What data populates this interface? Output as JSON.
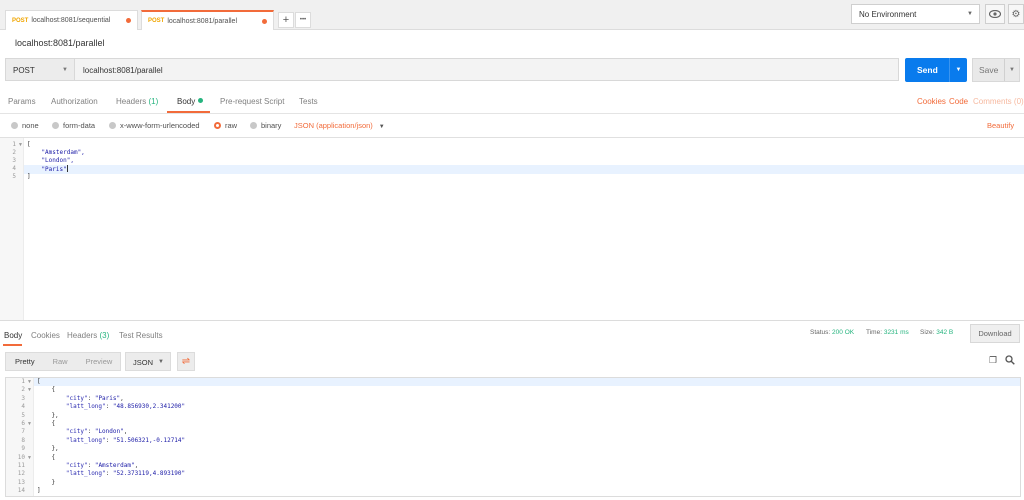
{
  "tabs": [
    {
      "method": "POST",
      "url": "localhost:8081/sequential"
    },
    {
      "method": "POST",
      "url": "localhost:8081/parallel"
    }
  ],
  "tab_actions": {
    "add": "+",
    "more": "•••"
  },
  "environment": {
    "selected": "No Environment"
  },
  "request": {
    "title": "localhost:8081/parallel",
    "method": "POST",
    "url": "localhost:8081/parallel",
    "send_label": "Send",
    "save_label": "Save"
  },
  "request_tabs": {
    "params": "Params",
    "authorization": "Authorization",
    "headers": "Headers",
    "headers_count": "(1)",
    "body": "Body",
    "prerequest": "Pre-request Script",
    "tests": "Tests",
    "cookies": "Cookies",
    "code": "Code",
    "comments": "Comments (0)"
  },
  "body_options": {
    "none": "none",
    "form_data": "form-data",
    "urlencoded": "x-www-form-urlencoded",
    "raw": "raw",
    "binary": "binary",
    "content_type": "JSON (application/json)",
    "beautify": "Beautify",
    "selected": "raw"
  },
  "request_body": {
    "line_numbers": [
      "1",
      "2",
      "3",
      "4",
      "5"
    ],
    "lines": [
      "[",
      "    \"Amsterdam\",",
      "    \"London\",",
      "    \"Paris\"",
      "]"
    ]
  },
  "response_tabs": {
    "body": "Body",
    "cookies": "Cookies",
    "headers": "Headers",
    "headers_count": "(3)",
    "test_results": "Test Results"
  },
  "response_status": {
    "status_label": "Status:",
    "status_value": "200 OK",
    "time_label": "Time:",
    "time_value": "3231 ms",
    "size_label": "Size:",
    "size_value": "342 B",
    "download_label": "Download"
  },
  "response_view": {
    "pretty": "Pretty",
    "raw": "Raw",
    "preview": "Preview",
    "format": "JSON"
  },
  "response_body": {
    "line_numbers": [
      "1",
      "2",
      "3",
      "4",
      "5",
      "6",
      "7",
      "8",
      "9",
      "10",
      "11",
      "12",
      "13",
      "14"
    ],
    "lines": [
      "[",
      "    {",
      "        \"city\": \"Paris\",",
      "        \"latt_long\": \"48.856930,2.341200\"",
      "    },",
      "    {",
      "        \"city\": \"London\",",
      "        \"latt_long\": \"51.506321,-0.12714\"",
      "    },",
      "    {",
      "        \"city\": \"Amsterdam\",",
      "        \"latt_long\": \"52.373119,4.893190\"",
      "    }",
      "]"
    ]
  },
  "colors": {
    "accent": "#f26b3a",
    "send": "#097bed",
    "success": "#26b47f",
    "method": "#f0a500"
  },
  "icons": {
    "eye": "eye-icon",
    "settings": "gear-icon",
    "wrap": "wrap-lines-icon",
    "copy": "copy-icon",
    "search": "search-icon"
  }
}
